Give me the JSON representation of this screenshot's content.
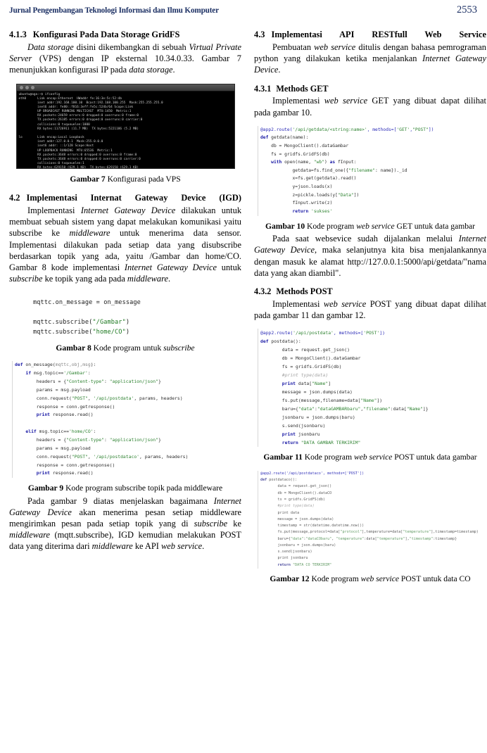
{
  "header": {
    "journal_title": "Jurnal Pengembangan Teknologi Informasi dan Ilmu Komputer",
    "page_number": "2553",
    "accent_color": "#1b2f63"
  },
  "left_column": {
    "section_413": {
      "number": "4.1.3",
      "title": "Konfigurasi Pada Data Storage GridFS",
      "paragraph_html": "<span class=\"it\">Data storage</span> disini dikembangkan di sebuah <span class=\"it\">Virtual Private Server</span> (VPS) dengan IP eksternal 10.34.0.33. Gambar 7 menunjukkan konfigurasi IP pada <span class=\"it\">data storage</span>."
    },
    "figure7": {
      "terminal_lines": [
        "ubuntu@aga:~$ ifconfig",
        "eth0      Link encap:Ethernet  HWaddr fe:16:3e:5c:52:4b",
        "          inet addr:192.168.100.10  Bcast:192.168.100.255  Mask:255.255.255.0",
        "          inet6 addr: fe80::f816:3eff:fe5c:524b/64 Scope:Link",
        "          UP BROADCAST RUNNING MULTICAST  MTU:1450  Metric:1",
        "          RX packets:24659 errors:0 dropped:0 overruns:0 frame:0",
        "          TX packets:26185 errors:0 dropped:0 overruns:0 carrier:0",
        "          collisions:0 txqueuelen:1000",
        "          RX bytes:11726911 (11.7 MB)  TX bytes:5221186 (5.2 MB)",
        "",
        "lo        Link encap:Local Loopback",
        "          inet addr:127.0.0.1  Mask:255.0.0.0",
        "          inet6 addr: ::1/128 Scope:Host",
        "          UP LOOPBACK RUNNING  MTU:65536  Metric:1",
        "          RX packets:3648 errors:0 dropped:0 overruns:0 frame:0",
        "          TX packets:3648 errors:0 dropped:0 overruns:0 carrier:0",
        "          collisions:0 txqueuelen:1",
        "          RX bytes:629158 (629.1 KB)  TX bytes:629158 (629.1 KB)"
      ],
      "caption_bold": "Gambar 7",
      "caption_text": "Konfigurasi pada VPS"
    },
    "section_42": {
      "number": "4.2",
      "title": "Implementasi Internat Gateway Device (IGD)",
      "paragraph_html": "Implementasi <span class=\"it\">Internet Gateway Device</span> dilakukan untuk membuat sebuah sistem yang dapat melakukan komunikasi yaitu subscribe ke <span class=\"it\">middleware</span> untuk menerima data sensor. Implementasi dilakukan pada setiap data yang disubscribe berdasarkan topik yang ada, yaitu /Gambar dan home/CO. Gambar 8 kode implementasi <span class=\"it\">Internet Gateway Device</span> untuk <span class=\"it\">subscribe</span> ke topik yang ada pada <span class=\"it\">middleware</span>."
    },
    "figure8": {
      "code_lines_html": [
        "mqttc.on_message = on_message",
        "",
        "mqttc.subscribe(<span class=\"str\">\"/Gambar\"</span>)",
        "mqttc.subscribe(<span class=\"str\">\"home/CO\"</span>)"
      ],
      "caption_bold": "Gambar 8",
      "caption_text": "Kode program untuk <span class=\"it\">subscribe</span>"
    },
    "figure9": {
      "code_lines_html": [
        "<span class=\"kw\">def</span> on_message(<span class=\"gy\">mqttc,obj,msg</span>):",
        "    <span class=\"kw\">if</span> msg.topic==<span class=\"str\">'/Gambar'</span>:",
        "        headers = {<span class=\"str\">\"Content-type\"</span>: <span class=\"str\">\"application/json\"</span>}",
        "        params = msg.payload",
        "        conn.request(<span class=\"str\">\"POST\"</span>, <span class=\"str\">'/api/postdata'</span>, params, headers)",
        "        response = conn.getresponse()",
        "        <span class=\"kw\">print</span> response.read()",
        "",
        "    <span class=\"kw\">elif</span> msg.topic==<span class=\"str\">'home/CO'</span>:",
        "        headers = {<span class=\"str\">\"Content-type\"</span>: <span class=\"str\">\"application/json\"</span>}",
        "        params = msg.payload",
        "        conn.request(<span class=\"str\">\"POST\"</span>, <span class=\"str\">'/api/postdataco'</span>, params, headers)",
        "        response = conn.getresponse()",
        "        <span class=\"kw\">print</span> response.read()"
      ],
      "caption_bold": "Gambar 9",
      "caption_text": "Kode program subscribe topik pada middleware"
    },
    "closing_paragraph_html": "Pada gambar 9 diatas menjelaskan bagaimana <span class=\"it\">Internet Gateway Device</span> akan menerima pesan setiap middleware mengirimkan pesan pada setiap topik yang di <span class=\"it\">subscribe</span> ke <span class=\"it\">middleware</span> (mqtt.subscribe), IGD kemudian melakukan POST data yang diterima dari <span class=\"it\">middleware</span> ke API <span class=\"it\">web service</span>."
  },
  "right_column": {
    "section_43": {
      "number": "4.3",
      "title": "Implementasi API RESTfull Web Service",
      "paragraph_html": "Pembuatan <span class=\"it\">web service</span> ditulis dengan bahasa pemrograman python yang dilakukan ketika menjalankan <span class=\"it\">Internet Gateway Device</span>."
    },
    "section_431": {
      "number": "4.3.1",
      "title": "Methods GET",
      "paragraph_html": "Implementasi <span class=\"it\">web service</span> GET yang dibuat dapat dilihat pada gambar 10."
    },
    "figure10": {
      "code_lines_html": [
        "<span class=\"bl\">@app2.route(</span><span class=\"str\">'/api/getdata/&lt;string:name&gt;'</span><span class=\"bl\">, methods=[</span><span class=\"str\">'GET'</span><span class=\"bl\">,</span><span class=\"str\">\"POST\"</span><span class=\"bl\">])</span>",
        "<span class=\"kw\">def</span> getdata(name):",
        "    db = MongoClient().dataGambar",
        "    fs = gridfs.GridFS(db)",
        "    <span class=\"kw\">with</span> open(name, <span class=\"str\">\"wb\"</span>) <span class=\"kw\">as</span> fInput:",
        "            getdata=fs.find_one({<span class=\"str\">\"filename\"</span>: name})._id",
        "            x=fs.get(getdata).read()",
        "            y=json.loads(x)",
        "            z=pickle.loads(y[<span class=\"str\">\"Data\"</span>])",
        "            fInput.write(z)",
        "            <span class=\"kw\">return</span> <span class=\"str\">'sukses'</span>"
      ],
      "caption_bold": "Gambar 10",
      "caption_text": "Kode program <span class=\"it\">web service</span> GET untuk data gambar"
    },
    "paragraph_webservice_html": "Pada saat websevice sudah dijalankan melalui <span class=\"it\">Internet Gateway Device</span>, maka selanjutnya kita bisa menjalankannya dengan masuk ke alamat http://127.0.0.1:5000/api/getdata/\"nama data yang akan diambil\".",
    "section_432": {
      "number": "4.3.2",
      "title": "Methods POST",
      "paragraph_html": "Implementasi <span class=\"it\">web service</span> POST yang dibuat dapat dilihat pada gambar 11 dan gambar 12."
    },
    "figure11": {
      "code_lines_html": [
        "<span class=\"bl\">@app2.route(</span><span class=\"str\">'/api/postdata'</span><span class=\"bl\">, methods=[</span><span class=\"str\">'POST'</span><span class=\"bl\">])</span>",
        "<span class=\"kw\">def</span> postdata():",
        "        data = request.get_json()",
        "        db = MongoClient().dataGambar",
        "        fs = gridfs.GridFS(db)",
        "        <span class=\"com\">#print type(data)</span>",
        "        <span class=\"kw\">print</span> data[<span class=\"str\">\"Name\"</span>]",
        "        message = json.dumps(data)",
        "        fs.put(message,filename=data[<span class=\"str\">\"Name\"</span>])",
        "        baru={<span class=\"str\">\"data\"</span>:<span class=\"str\">\"dataGAMBARbaru\"</span>,<span class=\"str\">\"filename\"</span>:data[<span class=\"str\">\"Name\"</span>]}",
        "        jsonbaru = json.dumps(baru)",
        "        s.send(jsonbaru)",
        "        <span class=\"kw\">print</span> jsonbaru",
        "        <span class=\"kw\">return</span> <span class=\"str\">\"DATA GAMBAR TERKIRIM\"</span>"
      ],
      "caption_bold": "Gambar 11",
      "caption_text": "Kode program <span class=\"it\">web service</span> POST untuk data gambar"
    },
    "figure12": {
      "code_lines_html": [
        "<span class=\"bl\">@app2.route('/api/postdataco', methods=['POST'])</span>",
        "<span class=\"kw\">def</span> postdataco():",
        "        data = request.get_json()",
        "        db = MongoClient().dataCO",
        "        ts = gridfs.GridFS(db)",
        "        <span class=\"com\">#print type(data)</span>",
        "        print data",
        "        message = json.dumps(data)",
        "        timestamp = str(datetime.datetime.now())",
        "        fs.put(message,protocol=data[<span class=\"str\">\"protocol\"</span>],temperature=data[<span class=\"str\">\"temperature\"</span>],timestamp=timestamp)",
        "        baru={<span class=\"str\">\"data\"</span>:<span class=\"str\">\"dataCObaru\"</span>, <span class=\"str\">\"temperature\"</span>:data[<span class=\"str\">\"temperature\"</span>],<span class=\"str\">\"timestamp\"</span>:timestamp}",
        "        jsonbaru = json.dumps(baru)",
        "        s.send(jsonbaru)",
        "        print jsonbaru",
        "        <span class=\"kw\">return</span> <span class=\"str\">\"DATA CO TERKIRIM\"</span>"
      ],
      "caption_bold": "Gambar 12",
      "caption_text": "Kode program <span class=\"it\">web service</span> POST untuk data CO"
    }
  }
}
